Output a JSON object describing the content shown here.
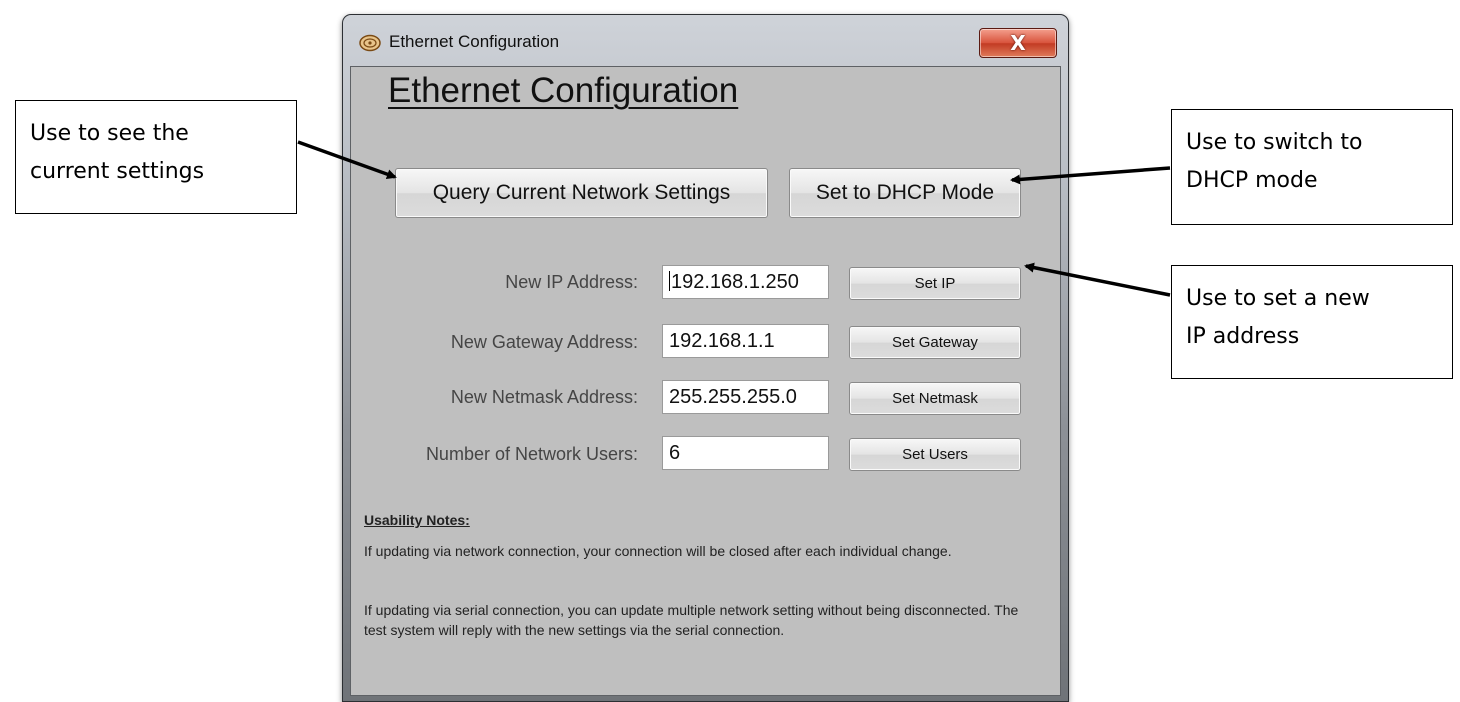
{
  "callouts": {
    "left": "Use to see the\ncurrent settings",
    "right_top": "Use to switch to\nDHCP mode",
    "right_bottom": "Use to set a new\nIP address"
  },
  "window": {
    "title": "Ethernet Configuration",
    "close_label": "X",
    "heading": "Ethernet Configuration"
  },
  "buttons": {
    "query": "Query Current Network Settings",
    "dhcp": "Set to DHCP Mode",
    "set_ip": "Set IP",
    "set_gateway": "Set Gateway",
    "set_netmask": "Set Netmask",
    "set_users": "Set Users"
  },
  "fields": {
    "ip_label": "New IP Address:",
    "ip_value": "192.168.1.250",
    "gateway_label": "New Gateway Address:",
    "gateway_value": "192.168.1.1",
    "netmask_label": "New Netmask Address:",
    "netmask_value": "255.255.255.0",
    "users_label": "Number of Network Users:",
    "users_value": "6"
  },
  "notes": {
    "heading": "Usability Notes:",
    "note1": "If updating via network connection, your connection will be closed after each individual change.",
    "note2": "If updating via serial connection, you can update multiple network setting without being disconnected.  The test system will reply with the new settings via the serial connection."
  },
  "colors": {
    "client_bg": "#bfbfbf",
    "close_button": "#d8533c"
  }
}
